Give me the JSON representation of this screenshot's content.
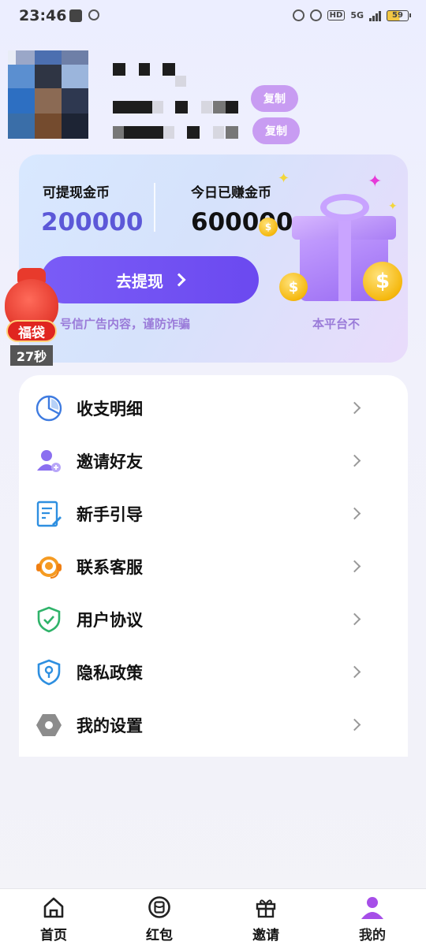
{
  "status_bar": {
    "time": "23:46",
    "network": "5G",
    "hd": "HD",
    "battery": "59"
  },
  "profile": {
    "copy_label_1": "复制",
    "copy_label_2": "复制"
  },
  "coin_card": {
    "withdrawable_label": "可提现金币",
    "withdrawable_value": "200000",
    "today_label": "今日已赚金币",
    "today_value": "600000",
    "withdraw_button": "去提现",
    "marquee_text_1": "号信广告内容，谨防诈骗",
    "marquee_text_2": "本平台不"
  },
  "lucky_bag": {
    "label": "福袋",
    "timer": "27秒"
  },
  "menu": {
    "items": [
      {
        "label": "收支明细",
        "icon": "pie-chart-icon"
      },
      {
        "label": "邀请好友",
        "icon": "add-user-icon"
      },
      {
        "label": "新手引导",
        "icon": "guide-document-icon"
      },
      {
        "label": "联系客服",
        "icon": "headset-icon"
      },
      {
        "label": "用户协议",
        "icon": "shield-check-icon"
      },
      {
        "label": "隐私政策",
        "icon": "privacy-shield-icon"
      },
      {
        "label": "我的设置",
        "icon": "settings-hexagon-icon"
      }
    ]
  },
  "bottom_nav": {
    "items": [
      {
        "label": "首页",
        "icon": "home-icon"
      },
      {
        "label": "红包",
        "icon": "red-packet-icon"
      },
      {
        "label": "邀请",
        "icon": "gift-icon"
      },
      {
        "label": "我的",
        "icon": "user-icon",
        "active": true
      }
    ]
  },
  "colors": {
    "primary": "#6b49f0",
    "copy_button": "#c89cf2",
    "active_nav": "#a64ee8"
  }
}
